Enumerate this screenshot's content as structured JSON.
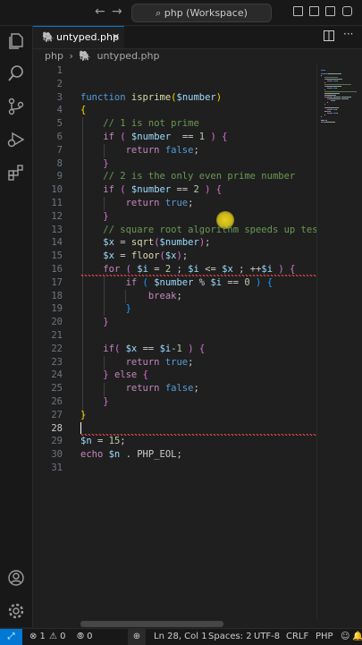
{
  "titlebar": {
    "back_glyph": "←",
    "forward_glyph": "→",
    "search_text": "⌕ php (Workspace)"
  },
  "tab": {
    "filename": "untyped.php",
    "close_glyph": "✕"
  },
  "breadcrumb": {
    "folder": "php",
    "separator": "›",
    "file": "untyped.php"
  },
  "editor": {
    "cursor_line": 28,
    "lines": [
      {
        "n": "1"
      },
      {
        "n": "2"
      },
      {
        "n": "3"
      },
      {
        "n": "4"
      },
      {
        "n": "5"
      },
      {
        "n": "6"
      },
      {
        "n": "7"
      },
      {
        "n": "8"
      },
      {
        "n": "9"
      },
      {
        "n": "10"
      },
      {
        "n": "11"
      },
      {
        "n": "12"
      },
      {
        "n": "13"
      },
      {
        "n": "14"
      },
      {
        "n": "15"
      },
      {
        "n": "16"
      },
      {
        "n": "17"
      },
      {
        "n": "18"
      },
      {
        "n": "19"
      },
      {
        "n": "20"
      },
      {
        "n": "21"
      },
      {
        "n": "22"
      },
      {
        "n": "23"
      },
      {
        "n": "24"
      },
      {
        "n": "25"
      },
      {
        "n": "26"
      },
      {
        "n": "27"
      },
      {
        "n": "28"
      },
      {
        "n": "29"
      },
      {
        "n": "30"
      },
      {
        "n": "31"
      }
    ],
    "code": [
      [
        [
          "tag",
          "<?php"
        ]
      ],
      [],
      [
        [
          "kw",
          "function "
        ],
        [
          "fn",
          "isprime"
        ],
        [
          "br1",
          "("
        ],
        [
          "var",
          "$number"
        ],
        [
          "br1",
          ")"
        ]
      ],
      [
        [
          "br1",
          "{"
        ]
      ],
      [
        [
          "ind",
          "    "
        ],
        [
          "cm",
          "// 1 is not prime"
        ]
      ],
      [
        [
          "ind",
          "    "
        ],
        [
          "ctl",
          "if "
        ],
        [
          "br2",
          "( "
        ],
        [
          "var",
          "$number"
        ],
        [
          "",
          "  == "
        ],
        [
          "num",
          "1"
        ],
        [
          "br2",
          " )"
        ],
        [
          "",
          " "
        ],
        [
          "br2",
          "{"
        ]
      ],
      [
        [
          "ind",
          "        "
        ],
        [
          "ctl",
          "return "
        ],
        [
          "kw",
          "false"
        ],
        [
          "",
          ";"
        ]
      ],
      [
        [
          "ind",
          "    "
        ],
        [
          "br2",
          "}"
        ]
      ],
      [
        [
          "ind",
          "    "
        ],
        [
          "cm",
          "// 2 is the only even prime number"
        ]
      ],
      [
        [
          "ind",
          "    "
        ],
        [
          "ctl",
          "if "
        ],
        [
          "br2",
          "( "
        ],
        [
          "var",
          "$number"
        ],
        [
          "",
          " == "
        ],
        [
          "num",
          "2"
        ],
        [
          "br2",
          " )"
        ],
        [
          "",
          " "
        ],
        [
          "br2",
          "{"
        ]
      ],
      [
        [
          "ind",
          "        "
        ],
        [
          "ctl",
          "return "
        ],
        [
          "kw",
          "true"
        ],
        [
          "",
          ";"
        ]
      ],
      [
        [
          "ind",
          "    "
        ],
        [
          "br2",
          "}"
        ]
      ],
      [
        [
          "ind",
          "    "
        ],
        [
          "cm",
          "// square root algorithm speeds up testi"
        ]
      ],
      [
        [
          "ind",
          "    "
        ],
        [
          "var",
          "$x"
        ],
        [
          "",
          " = "
        ],
        [
          "fn",
          "sqrt"
        ],
        [
          "br2",
          "("
        ],
        [
          "var",
          "$number"
        ],
        [
          "br2",
          ")"
        ],
        [
          "",
          ";"
        ]
      ],
      [
        [
          "ind",
          "    "
        ],
        [
          "var",
          "$x"
        ],
        [
          "",
          " = "
        ],
        [
          "fn",
          "floor"
        ],
        [
          "br2",
          "("
        ],
        [
          "var",
          "$x"
        ],
        [
          "br2",
          ")"
        ],
        [
          "",
          ";"
        ]
      ],
      [
        [
          "ind",
          "    "
        ],
        [
          "ctl",
          "for "
        ],
        [
          "br2",
          "( "
        ],
        [
          "var",
          "$i"
        ],
        [
          "",
          " = "
        ],
        [
          "num",
          "2"
        ],
        [
          "",
          " ; "
        ],
        [
          "var",
          "$i"
        ],
        [
          "",
          " &lt;= "
        ],
        [
          "var",
          "$x"
        ],
        [
          "",
          " ; ++"
        ],
        [
          "var",
          "$i"
        ],
        [
          "br2",
          " )"
        ],
        [
          "",
          " "
        ],
        [
          "br2",
          "{"
        ]
      ],
      [
        [
          "ind",
          "        "
        ],
        [
          "ctl",
          "if "
        ],
        [
          "br3",
          "( "
        ],
        [
          "var",
          "$number"
        ],
        [
          "",
          " % "
        ],
        [
          "var",
          "$i"
        ],
        [
          "",
          " == "
        ],
        [
          "num",
          "0"
        ],
        [
          "br3",
          " )"
        ],
        [
          "",
          " "
        ],
        [
          "br3",
          "{"
        ]
      ],
      [
        [
          "ind",
          "            "
        ],
        [
          "ctl",
          "break"
        ],
        [
          "",
          ";"
        ]
      ],
      [
        [
          "ind",
          "        "
        ],
        [
          "br3",
          "}"
        ]
      ],
      [
        [
          "ind",
          "    "
        ],
        [
          "br2",
          "}"
        ]
      ],
      [],
      [
        [
          "ind",
          "    "
        ],
        [
          "ctl",
          "if"
        ],
        [
          "br2",
          "( "
        ],
        [
          "var",
          "$x"
        ],
        [
          "",
          " == "
        ],
        [
          "var",
          "$i"
        ],
        [
          "",
          "-"
        ],
        [
          "num",
          "1"
        ],
        [
          "br2",
          " )"
        ],
        [
          "",
          " "
        ],
        [
          "br2",
          "{"
        ]
      ],
      [
        [
          "ind",
          "        "
        ],
        [
          "ctl",
          "return "
        ],
        [
          "kw",
          "true"
        ],
        [
          "",
          ";"
        ]
      ],
      [
        [
          "ind",
          "    "
        ],
        [
          "br2",
          "}"
        ],
        [
          "",
          " "
        ],
        [
          "ctl",
          "else "
        ],
        [
          "br2",
          "{"
        ]
      ],
      [
        [
          "ind",
          "        "
        ],
        [
          "ctl",
          "return "
        ],
        [
          "kw",
          "false"
        ],
        [
          "",
          ";"
        ]
      ],
      [
        [
          "ind",
          "    "
        ],
        [
          "br2",
          "}"
        ]
      ],
      [
        [
          "br1",
          "}"
        ]
      ],
      [],
      [
        [
          "var",
          "$n"
        ],
        [
          "",
          " = "
        ],
        [
          "num",
          "15"
        ],
        [
          "",
          ";"
        ]
      ],
      [
        [
          "ctl",
          "echo "
        ],
        [
          "var",
          "$n"
        ],
        [
          "",
          " . PHP_EOL;"
        ]
      ],
      []
    ]
  },
  "statusbar": {
    "remote_glyph": "⤢",
    "errors": "⊗ 1",
    "warnings": "⚠ 0",
    "ports": "⦾ 0",
    "zoom_glyph": "⊕",
    "position": "Ln 28, Col 1",
    "spaces": "Spaces: 2",
    "encoding": "UTF-8",
    "eol": "CRLF",
    "language": "PHP"
  },
  "colors": {
    "accent": "#0078d4",
    "comment": "#6a9955",
    "keyword": "#569cd6",
    "control": "#c586c0",
    "function": "#dcdcaa",
    "variable": "#9cdcfe",
    "number": "#b5cea8",
    "error_squiggle": "#f14c4c"
  },
  "icons": [
    "explorer-icon",
    "search-icon",
    "source-control-icon",
    "run-debug-icon",
    "extensions-icon",
    "account-icon",
    "manage-gear-icon",
    "layout-sidebar-icon",
    "layout-panel-icon",
    "layout-secondary-icon",
    "layout-customize-icon",
    "split-editor-icon",
    "more-actions-icon",
    "bell-icon",
    "feedback-icon"
  ]
}
